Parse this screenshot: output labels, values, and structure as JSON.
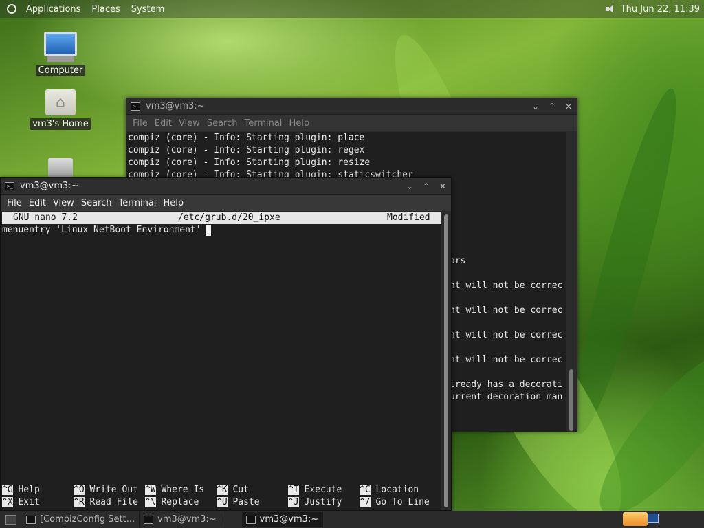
{
  "top_panel": {
    "menus": [
      "Applications",
      "Places",
      "System"
    ],
    "clock": "Thu Jun 22, 11:39"
  },
  "desktop_icons": {
    "computer": "Computer",
    "home": "vm3's Home"
  },
  "bg_window": {
    "title": "vm3@vm3:~",
    "menu": [
      "File",
      "Edit",
      "View",
      "Search",
      "Terminal",
      "Help"
    ],
    "lines": [
      "compiz (core) - Info: Starting plugin: place",
      "compiz (core) - Info: Starting plugin: regex",
      "compiz (core) - Info: Starting plugin: resize",
      "compiz (core) - Info: Starting plugin: staticswitcher"
    ],
    "fragments": [
      "ors",
      "nt will not be correc",
      "nt will not be correc",
      "nt will not be correc",
      "nt will not be correc",
      "lready has a decorati",
      "urrent decoration man"
    ]
  },
  "fg_window": {
    "title": "vm3@vm3:~",
    "menu": [
      "File",
      "Edit",
      "View",
      "Search",
      "Terminal",
      "Help"
    ],
    "nano": {
      "version": "GNU nano 7.2",
      "filename": "/etc/grub.d/20_ipxe",
      "status": "Modified",
      "content": "menuentry 'Linux NetBoot Environment'"
    },
    "shortcuts_row1": [
      {
        "key": "^G",
        "label": "Help"
      },
      {
        "key": "^O",
        "label": "Write Out"
      },
      {
        "key": "^W",
        "label": "Where Is"
      },
      {
        "key": "^K",
        "label": "Cut"
      },
      {
        "key": "^T",
        "label": "Execute"
      },
      {
        "key": "^C",
        "label": "Location"
      }
    ],
    "shortcuts_row2": [
      {
        "key": "^X",
        "label": "Exit"
      },
      {
        "key": "^R",
        "label": "Read File"
      },
      {
        "key": "^\\",
        "label": "Replace"
      },
      {
        "key": "^U",
        "label": "Paste"
      },
      {
        "key": "^J",
        "label": "Justify"
      },
      {
        "key": "^/",
        "label": "Go To Line"
      }
    ]
  },
  "taskbar": {
    "tasks": [
      "[CompizConfig Sett...",
      "vm3@vm3:~",
      "vm3@vm3:~"
    ]
  }
}
